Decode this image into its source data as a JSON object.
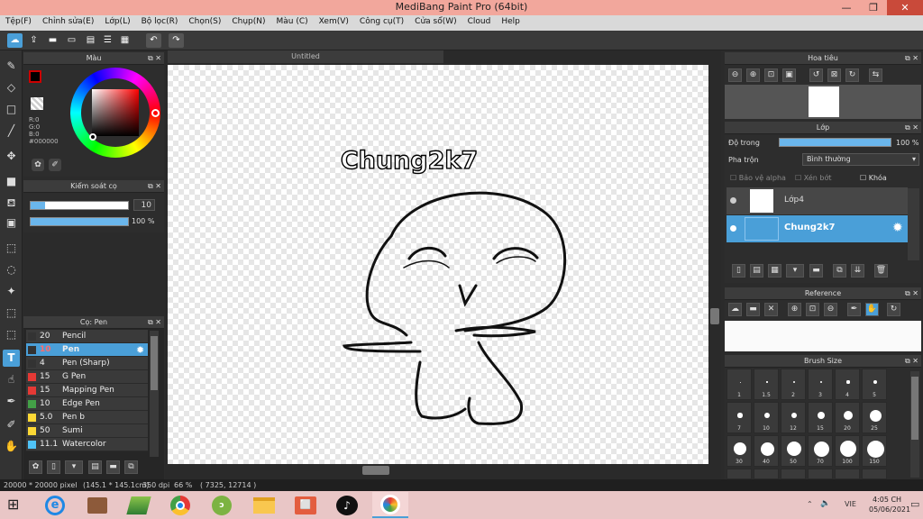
{
  "window": {
    "title": "MediBang Paint Pro (64bit)"
  },
  "menu": [
    "Tệp(F)",
    "Chỉnh sửa(E)",
    "Lớp(L)",
    "Bộ lọc(R)",
    "Chọn(S)",
    "Chụp(N)",
    "Màu (C)",
    "Xem(V)",
    "Công cụ(T)",
    "Cửa sổ(W)",
    "Cloud",
    "Help"
  ],
  "color_panel": {
    "title": "Màu",
    "r": "R:0",
    "g": "G:0",
    "b": "B:0",
    "hex": "#000000"
  },
  "brush_control": {
    "title": "Kiểm soát cọ",
    "size": "10",
    "opacity": "100 %",
    "size_fraction": 0.15,
    "opacity_fraction": 1.0
  },
  "brush_panel": {
    "title": "Cọ: Pen",
    "items": [
      {
        "size": "20",
        "name": "Pencil",
        "color": "#333333"
      },
      {
        "size": "10",
        "name": "Pen",
        "color": "#333333",
        "selected": true
      },
      {
        "size": "4",
        "name": "Pen (Sharp)",
        "color": "#333333"
      },
      {
        "size": "15",
        "name": "G Pen",
        "color": "#e53935"
      },
      {
        "size": "15",
        "name": "Mapping Pen",
        "color": "#e53935"
      },
      {
        "size": "10",
        "name": "Edge Pen",
        "color": "#43a047"
      },
      {
        "size": "5.0",
        "name": "Pen b",
        "color": "#fdd835"
      },
      {
        "size": "50",
        "name": "Sumi",
        "color": "#fdd835"
      },
      {
        "size": "11.1",
        "name": "Watercolor",
        "color": "#4fc3f7"
      }
    ]
  },
  "canvas": {
    "tab": "Untitled",
    "text": "Chung2k7"
  },
  "navigator": {
    "title": "Hoa tiêu"
  },
  "layer_panel": {
    "title": "Lớp",
    "opacity_label": "Độ trong",
    "opacity": "100 %",
    "opacity_fraction": 1.0,
    "blend_label": "Pha trộn",
    "blend_value": "Bình thường",
    "protect_alpha": "Bảo vệ alpha",
    "clipping": "Xén bớt",
    "lock": "Khóa",
    "layers": [
      {
        "name": "Lớp4",
        "selected": false
      },
      {
        "name": "Chung2k7",
        "selected": true
      }
    ]
  },
  "reference": {
    "title": "Reference"
  },
  "brush_size": {
    "title": "Brush Size",
    "sizes": [
      "1",
      "1.5",
      "2",
      "3",
      "4",
      "5",
      "7",
      "10",
      "12",
      "15",
      "20",
      "25",
      "30",
      "40",
      "50",
      "70",
      "100",
      "150"
    ]
  },
  "status": {
    "dimensions": "20000 * 20000 pixel",
    "size": "(145.1 * 145.1cm)",
    "dpi": "350 dpi",
    "zoom": "66 %",
    "coords": "( 7325, 12714 )"
  },
  "taskbar": {
    "time": "4:05 CH",
    "date": "05/06/2021",
    "lang": "VIE"
  },
  "colors": {
    "accent": "#4a9fd8",
    "title_bg": "#f2a79c"
  }
}
